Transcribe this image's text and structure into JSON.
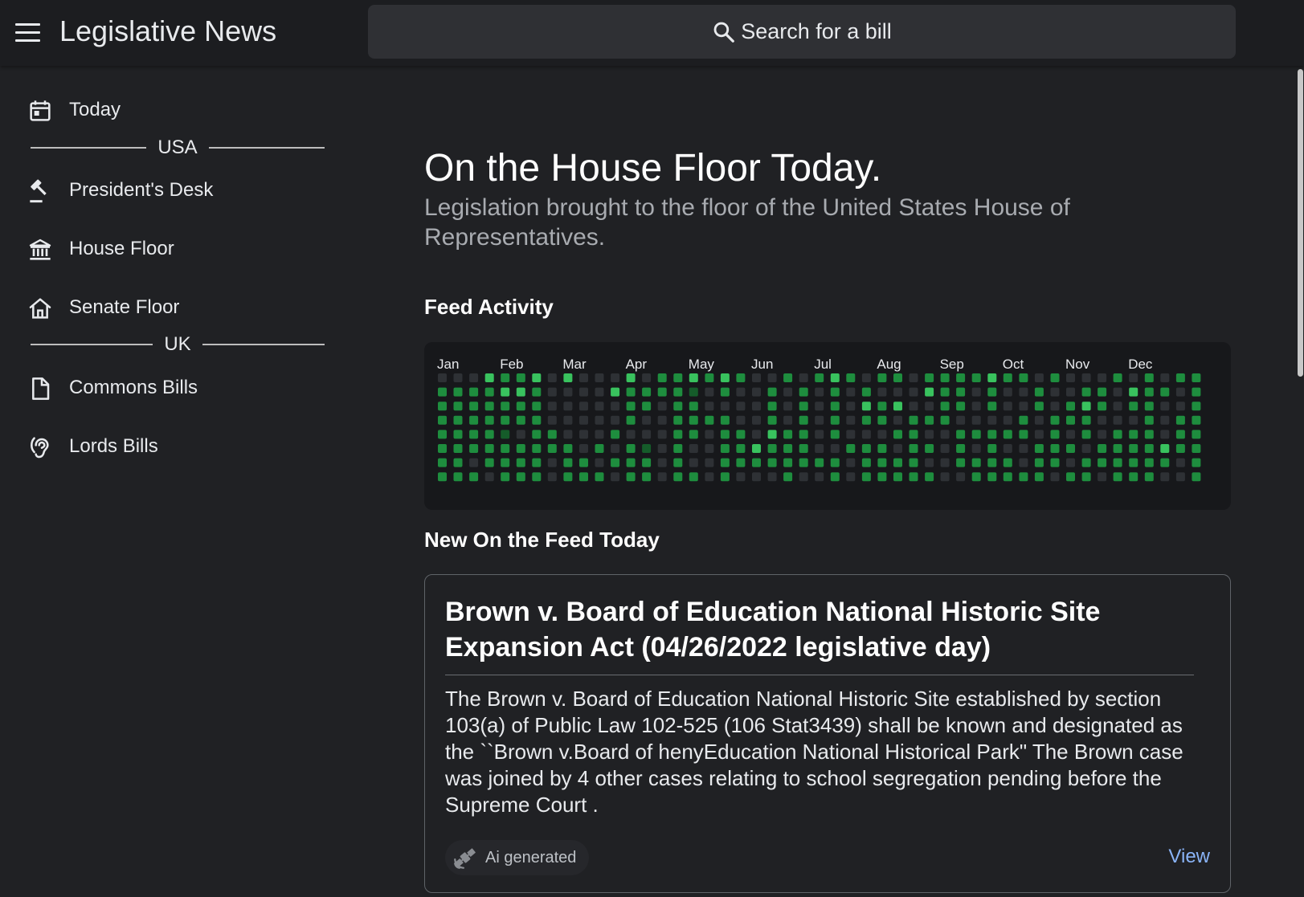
{
  "app": {
    "title": "Legislative News",
    "menu_icon": "menu-icon"
  },
  "search": {
    "label": "Search for a bill",
    "icon": "search-icon"
  },
  "sidebar": {
    "today": {
      "label": "Today",
      "icon": "calendar-icon"
    },
    "sections": [
      {
        "title": "USA",
        "items": [
          {
            "label": "President's Desk",
            "icon": "gavel-icon"
          },
          {
            "label": "House Floor",
            "icon": "institution-icon"
          },
          {
            "label": "Senate Floor",
            "icon": "house-icon"
          }
        ]
      },
      {
        "title": "UK",
        "items": [
          {
            "label": "Commons Bills",
            "icon": "document-icon"
          },
          {
            "label": "Lords Bills",
            "icon": "hearing-icon"
          }
        ]
      }
    ]
  },
  "main": {
    "title": "On the House Floor Today.",
    "subtitle": "Legislation brought to the floor of the United States House of Representatives.",
    "feed_activity_heading": "Feed Activity",
    "new_today_heading": "New On the Feed Today"
  },
  "chart_data": {
    "type": "heatmap",
    "month_labels": [
      "Jan",
      "Feb",
      "Mar",
      "Apr",
      "May",
      "Jun",
      "Jul",
      "Aug",
      "Sep",
      "Oct",
      "Nov",
      "Dec"
    ],
    "weeks": 48,
    "rows": 8,
    "levels": {
      "0": "none",
      "1": "low",
      "2": "medium",
      "3": "high"
    },
    "colors": [
      "#2e3135",
      "#155c2a",
      "#1e8d3e",
      "#39c25e"
    ],
    "cells": [
      "02222222",
      "02222222",
      "02222202",
      "32222220",
      "23221222",
      "23220222",
      "32222222",
      "00002200",
      "30000222",
      "00000022",
      "00000202",
      "03002020",
      "32220222",
      "02200122",
      "22000000",
      "22222222",
      "31222002",
      "20020000",
      "32022222",
      "20002220",
      "00000320",
      "02223220",
      "20002222",
      "02222220",
      "20000020",
      "32222022",
      "20000200",
      "02320222",
      "20220222",
      "20302022",
      "00022222",
      "23020202",
      "22220000",
      "22202220",
      "20002022",
      "32202222",
      "20002022",
      "20022002",
      "02200222",
      "20022220",
      "00220202",
      "02322022",
      "02200220",
      "20002222",
      "03202222",
      "22222222",
      "02000320",
      "20022200",
      "22222222"
    ],
    "cells_note": ""
  },
  "bill": {
    "title": "Brown v. Board of Education National Historic Site Expansion Act (04/26/2022 legislative day)",
    "summary": "The Brown v. Board of Education National Historic Site established by section 103(a) of Public Law 102-525 (106 Stat3439) shall be known and designated as the ``Brown v.Board of henyEducation National Historical Park\" The Brown case was joined by 4 other cases relating to school segregation pending before the Supreme Court .",
    "badge_label": "Ai generated",
    "badge_icon": "satellite-icon",
    "view_label": "View"
  }
}
